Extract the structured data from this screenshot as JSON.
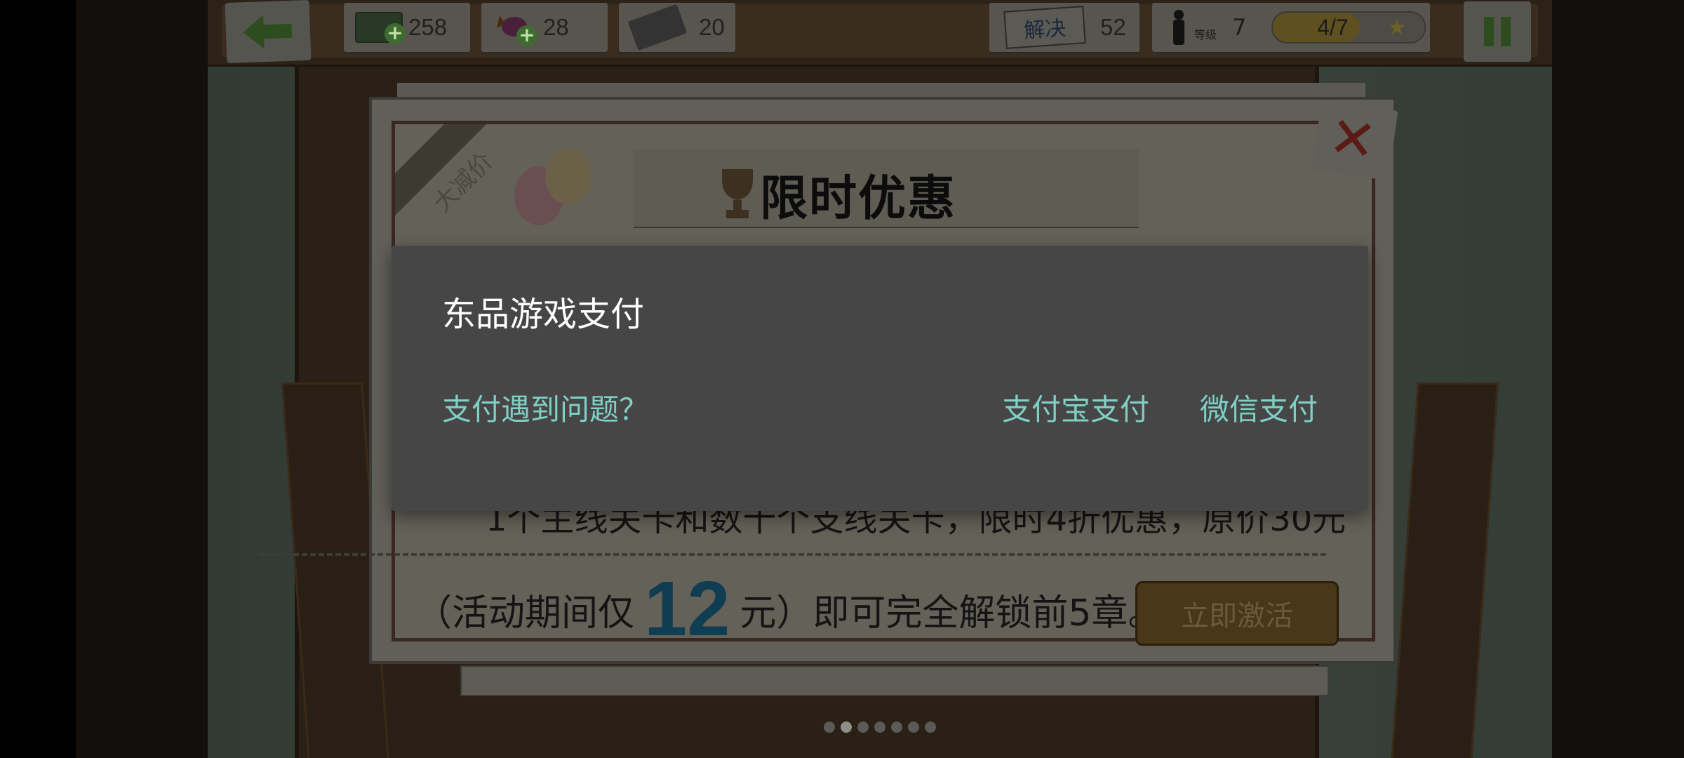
{
  "hud": {
    "cash": "258",
    "candy": "28",
    "newspaper": "20",
    "solved_label": "解决",
    "solved": "52",
    "level_label": "等级",
    "level": "7",
    "progress_text": "4/7",
    "progress_fraction": 0.5714
  },
  "poster": {
    "corner_ribbon": "大减价",
    "title": "限时优惠",
    "line1": "1个主线关卡和数十个支线关卡，限时4折优惠，原价30元",
    "line2_prefix": "（活动期间仅",
    "price": "12",
    "line2_suffix": "元）即可完全解锁前5章。",
    "activate_label": "立即激活"
  },
  "dialog": {
    "title": "东品游戏支付",
    "help_link": "支付遇到问题？",
    "alipay_button": "支付宝支付",
    "wechat_button": "微信支付"
  },
  "pager": {
    "count": 7,
    "active": 1
  },
  "colors": {
    "dialog_bg": "#464646",
    "link": "#7fd0c5",
    "title": "#ffffff"
  },
  "icons": [
    "back-arrow-icon",
    "cash-icon",
    "candy-icon",
    "newspaper-icon",
    "detective-icon",
    "star-icon",
    "pause-icon",
    "close-icon",
    "trophy-icon"
  ]
}
